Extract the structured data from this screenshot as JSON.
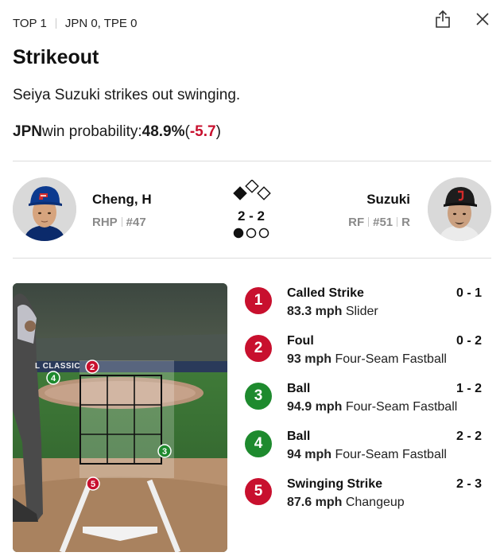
{
  "header": {
    "inning": "TOP 1",
    "score": "JPN 0, TPE 0"
  },
  "event": {
    "title": "Strikeout",
    "description": "Seiya Suzuki strikes out swinging.",
    "win_prob": {
      "team": "JPN",
      "label": "win probability:",
      "value": "48.9%",
      "delta_open": "(",
      "delta": "-5.7",
      "delta_close": ")"
    }
  },
  "matchup": {
    "pitcher": {
      "name": "Cheng, H",
      "hand": "RHP",
      "number": "#47"
    },
    "batter": {
      "name": "Suzuki",
      "position": "RF",
      "number": "#51",
      "bats": "R"
    },
    "count": "2 - 2",
    "bases": {
      "first": false,
      "second": false,
      "third": true
    },
    "outs": 1
  },
  "field_text": "L CLASSIC",
  "pitches": [
    {
      "num": "1",
      "result": "Called Strike",
      "count": "0 - 1",
      "speed": "83.3 mph",
      "type": "Slider",
      "color": "#c8102e",
      "in_view": false
    },
    {
      "num": "2",
      "result": "Foul",
      "count": "0 - 2",
      "speed": "93 mph",
      "type": "Four-Seam Fastball",
      "color": "#c8102e",
      "in_view": true
    },
    {
      "num": "3",
      "result": "Ball",
      "count": "1 - 2",
      "speed": "94.9 mph",
      "type": "Four-Seam Fastball",
      "color": "#1e8a2e",
      "in_view": true
    },
    {
      "num": "4",
      "result": "Ball",
      "count": "2 - 2",
      "speed": "94 mph",
      "type": "Four-Seam Fastball",
      "color": "#1e8a2e",
      "in_view": true
    },
    {
      "num": "5",
      "result": "Swinging Strike",
      "count": "2 - 3",
      "speed": "87.6 mph",
      "type": "Changeup",
      "color": "#c8102e",
      "in_view": true
    }
  ]
}
